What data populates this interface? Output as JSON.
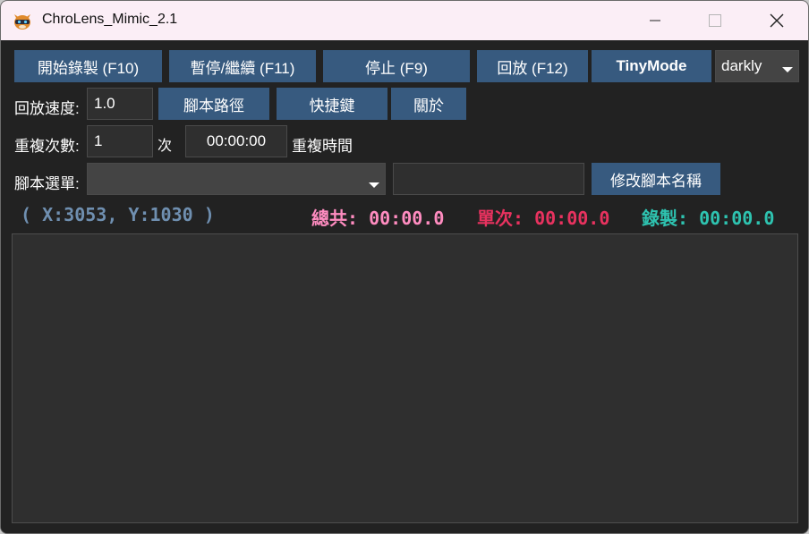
{
  "window": {
    "title": "ChroLens_Mimic_2.1"
  },
  "toolbar": {
    "record": "開始錄製 (F10)",
    "pause": "暫停/繼續 (F11)",
    "stop": "停止 (F9)",
    "playback": "回放 (F12)",
    "tiny_mode": "TinyMode",
    "theme_value": "darkly"
  },
  "row2": {
    "speed_label": "回放速度:",
    "speed_value": "1.0",
    "script_path": "腳本路徑",
    "hotkeys": "快捷鍵",
    "about": "關於"
  },
  "row3": {
    "repeat_label": "重複次數:",
    "repeat_value": "1",
    "times_unit": "次",
    "repeat_time_value": "00:00:00",
    "repeat_time_label": "重複時間"
  },
  "row4": {
    "script_menu_label": "腳本選單:",
    "script_menu_value": "",
    "rename_value": "",
    "rename_button": "修改腳本名稱"
  },
  "status": {
    "coords": "( X:3053, Y:1030 )",
    "total": "總共: 00:00.0",
    "single": "單次: 00:00.0",
    "recording": "錄製: 00:00.0"
  },
  "colors": {
    "button": "#375a7f",
    "background": "#222222",
    "coords": "#6f8fb0",
    "total": "#ff8cc0",
    "single": "#e8325f",
    "recording": "#2ec3b0"
  }
}
